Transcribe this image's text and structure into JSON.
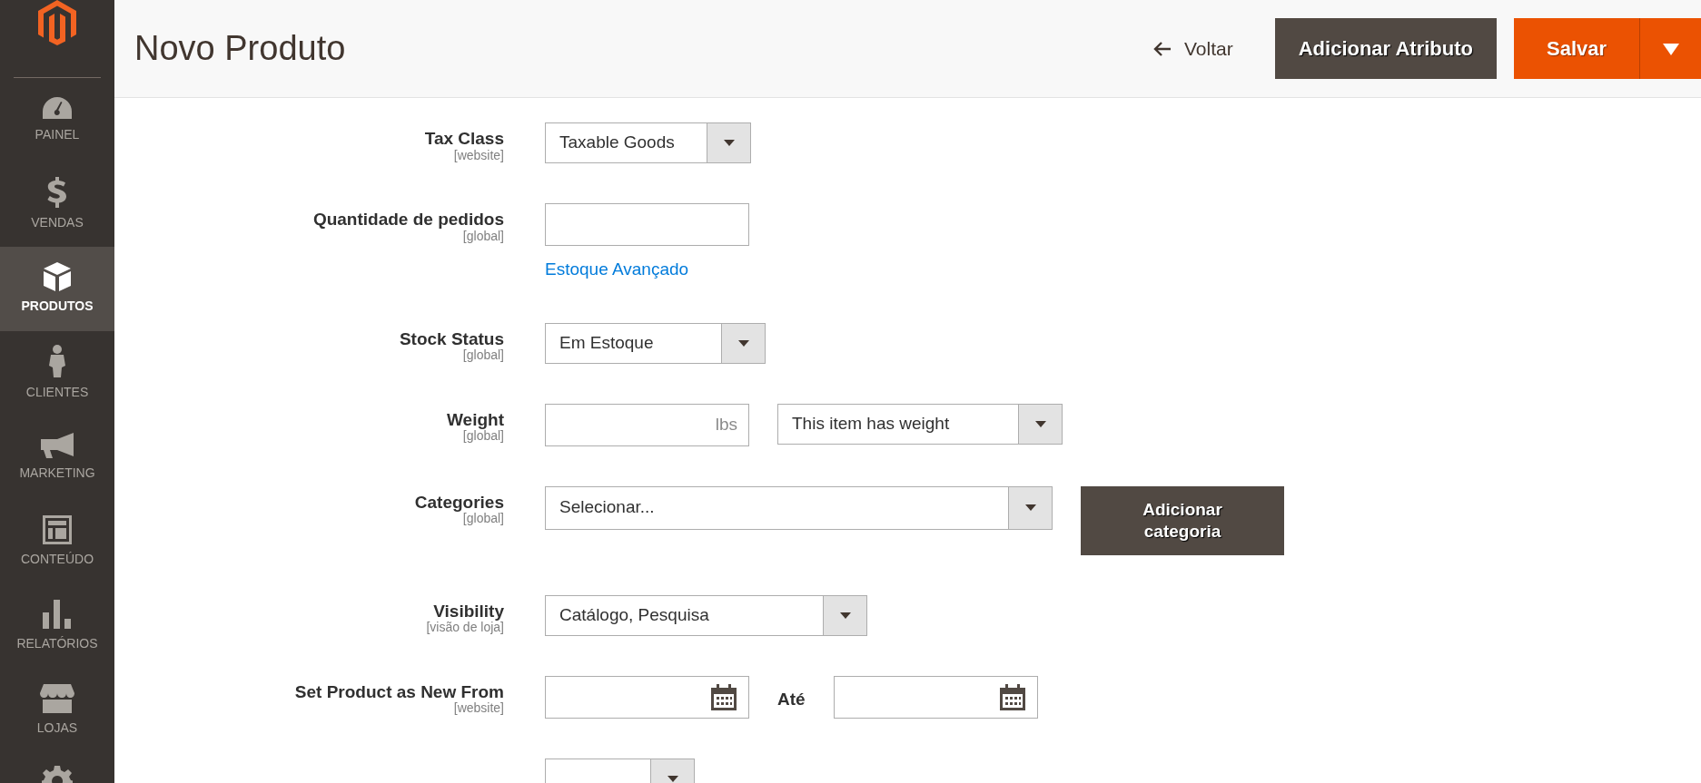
{
  "sidebar": {
    "items": [
      {
        "label": "PAINEL",
        "selected": false
      },
      {
        "label": "VENDAS",
        "selected": false
      },
      {
        "label": "PRODUTOS",
        "selected": true
      },
      {
        "label": "CLIENTES",
        "selected": false
      },
      {
        "label": "MARKETING",
        "selected": false
      },
      {
        "label": "CONTEÚDO",
        "selected": false
      },
      {
        "label": "RELATÓRIOS",
        "selected": false
      },
      {
        "label": "LOJAS",
        "selected": false
      },
      {
        "selected": false
      }
    ]
  },
  "header": {
    "title": "Novo Produto",
    "back_link": "Voltar",
    "add_attribute_button": "Adicionar Atributo",
    "save_button": "Salvar"
  },
  "fields": [
    {
      "label": "Tax Class",
      "scope": "[website]",
      "controls": [
        {
          "kind": "select",
          "value": "Taxable Goods"
        }
      ]
    },
    {
      "label": "Quantidade de pedidos",
      "scope": "[global]",
      "controls": [
        {
          "kind": "input"
        }
      ],
      "link": "Estoque Avançado"
    },
    {
      "label": "Stock Status",
      "scope": "[global]",
      "controls": [
        {
          "kind": "select",
          "value": "Em Estoque"
        }
      ]
    },
    {
      "label": "Weight",
      "scope": "[global]",
      "controls": [
        {
          "kind": "input",
          "unit": "lbs"
        },
        {
          "kind": "select",
          "value": "This item has weight"
        }
      ]
    },
    {
      "label": "Categories",
      "scope": "[global]",
      "controls": [
        {
          "kind": "select",
          "value": "Selecionar..."
        },
        {
          "kind": "button",
          "value": "Adicionar categoria"
        }
      ]
    },
    {
      "label": "Visibility",
      "scope": "[visão de loja]",
      "controls": [
        {
          "kind": "select",
          "value": "Catálogo, Pesquisa"
        }
      ]
    },
    {
      "label": "Set Product as New From",
      "scope": "[website]",
      "controls": [
        {
          "kind": "date"
        },
        {
          "kind": "text",
          "value": "Até"
        },
        {
          "kind": "date"
        }
      ]
    },
    {
      "controls": [
        {
          "kind": "select"
        }
      ]
    }
  ]
}
